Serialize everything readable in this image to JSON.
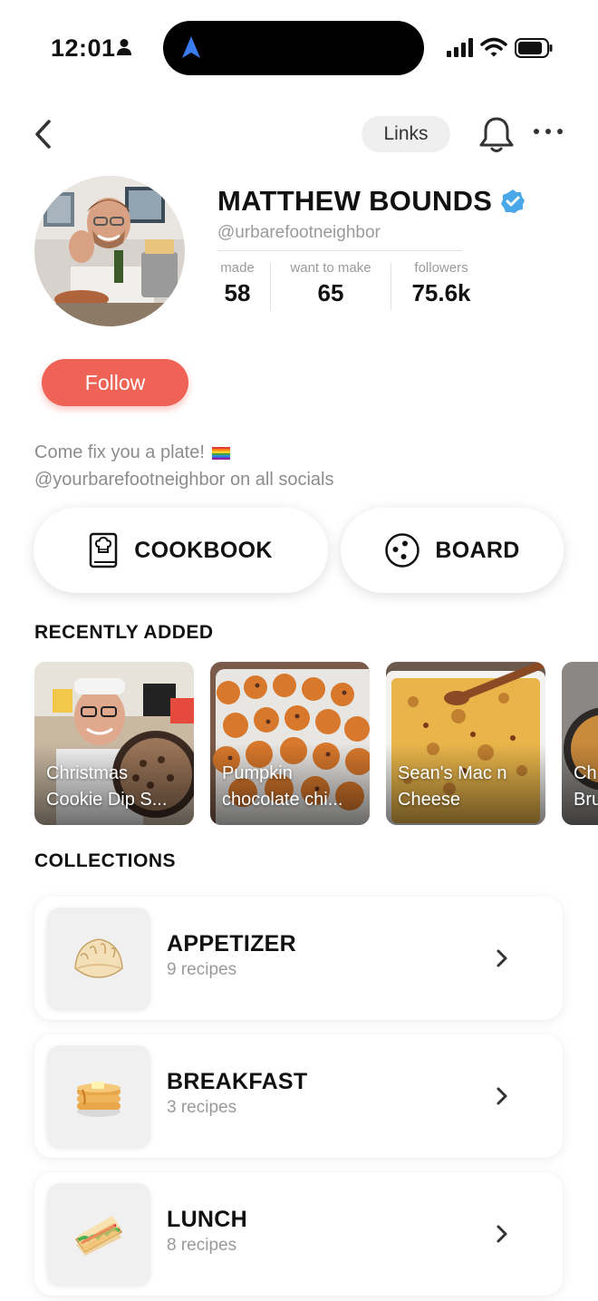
{
  "status": {
    "time": "12:01"
  },
  "header": {
    "links_label": "Links"
  },
  "profile": {
    "name": "MATTHEW BOUNDS",
    "handle": "@urbarefootneighbor",
    "stats": [
      {
        "label": "made",
        "value": "58"
      },
      {
        "label": "want to make",
        "value": "65"
      },
      {
        "label": "followers",
        "value": "75.6k"
      }
    ],
    "follow_label": "Follow",
    "bio_line1": "Come fix you a plate!",
    "bio_line2": "@yourbarefootneighbor on all socials"
  },
  "actions": {
    "cookbook_label": "COOKBOOK",
    "board_label": "BOARD"
  },
  "recently_added": {
    "title": "RECENTLY ADDED",
    "items": [
      {
        "line1": "Christmas",
        "line2": "Cookie Dip S..."
      },
      {
        "line1": "Pumpkin",
        "line2": "chocolate chi..."
      },
      {
        "line1": "Sean's Mac n",
        "line2": "Cheese"
      },
      {
        "line1": "Ch",
        "line2": "Bru"
      }
    ]
  },
  "collections": {
    "title": "COLLECTIONS",
    "items": [
      {
        "title": "APPETIZER",
        "count": "9 recipes",
        "icon": "dumpling-icon"
      },
      {
        "title": "BREAKFAST",
        "count": "3 recipes",
        "icon": "pancakes-icon"
      },
      {
        "title": "LUNCH",
        "count": "8 recipes",
        "icon": "sandwich-icon"
      }
    ]
  },
  "colors": {
    "accent": "#ee6355",
    "verified": "#4aa8e8"
  }
}
